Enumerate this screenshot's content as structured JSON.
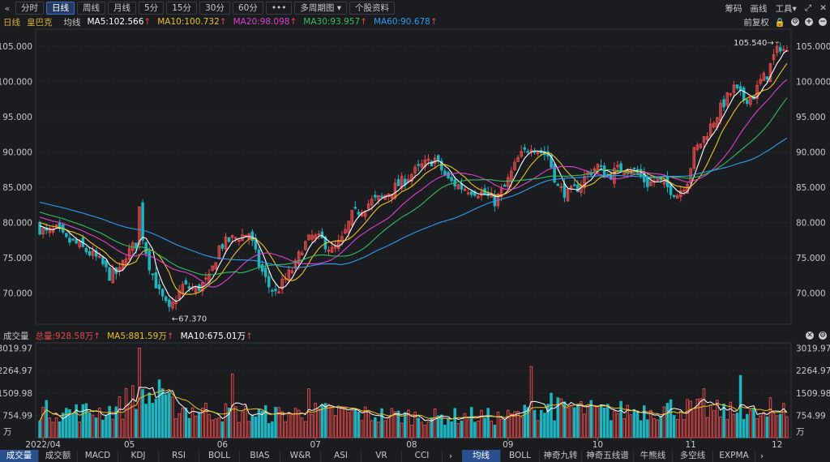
{
  "toolbar": {
    "back_icon": "double-chevron-left-icon",
    "buttons": [
      "分时",
      "日线",
      "周线",
      "月线",
      "5分",
      "15分",
      "30分",
      "60分",
      "•••",
      "多周期图",
      "个股资料"
    ],
    "active": "日线",
    "dropdown_arrow": "▾",
    "right_items": [
      "筹码",
      "画线",
      "工具"
    ],
    "right_caret": "▾",
    "window_icons": [
      "fullscreen-icon",
      "close-icon"
    ]
  },
  "ma_header": {
    "period": "日线",
    "stock_name": "皇巴克",
    "avg_label": "均线",
    "ma5": "MA5:102.566",
    "ma10": "MA10:100.732",
    "ma20": "MA20:98.098",
    "ma30": "MA30:93.957",
    "ma60": "MA60:90.678",
    "arrow": "↑",
    "adjust": "前复权"
  },
  "vol_header": {
    "label": "成交量",
    "total": "总量:928.58万",
    "ma5": "MA5:881.59万",
    "ma10": "MA10:675.01万",
    "arrow": "↑"
  },
  "colors": {
    "up": "#e34b4b",
    "down": "#1fb4bf",
    "ma5": "#ffffff",
    "ma10": "#f0c020",
    "ma20": "#e040d0",
    "ma30": "#30c060",
    "ma60": "#2a9df4",
    "grid": "#2e3038",
    "axis_text": "#c8c8c8"
  },
  "price_axis": {
    "ticks": [
      "105.000",
      "100.000",
      "95.000",
      "90.000",
      "85.000",
      "80.000",
      "75.000",
      "70.000"
    ],
    "values": [
      105,
      100,
      95,
      90,
      85,
      80,
      75,
      70
    ],
    "range": [
      65.6,
      107.4
    ]
  },
  "volume_axis": {
    "ticks": [
      "3019.97",
      "2264.97",
      "1509.98",
      "754.99"
    ],
    "values": [
      3019.97,
      2264.97,
      1509.98,
      754.99
    ],
    "unit": "万",
    "range": [
      0,
      3200
    ]
  },
  "x_axis": {
    "labels": [
      "2022/04",
      "05",
      "06",
      "07",
      "08",
      "09",
      "10",
      "11",
      "12"
    ],
    "indices": [
      1,
      27,
      55,
      83,
      112,
      141,
      168,
      196,
      222
    ]
  },
  "annotations": {
    "high": "105.540",
    "low": "67.370"
  },
  "chart_data": {
    "type": "candlestick",
    "title": "",
    "days": 226,
    "anchors": [
      [
        0,
        79.5
      ],
      [
        3,
        78.5
      ],
      [
        6,
        79
      ],
      [
        9,
        77.5
      ],
      [
        12,
        77
      ],
      [
        15,
        76
      ],
      [
        18,
        75
      ],
      [
        20,
        74
      ],
      [
        22,
        72.5
      ],
      [
        25,
        73
      ],
      [
        27,
        75.5
      ],
      [
        30,
        77
      ],
      [
        31,
        82
      ],
      [
        32,
        78
      ],
      [
        34,
        74
      ],
      [
        37,
        70
      ],
      [
        40,
        67.5
      ],
      [
        44,
        71
      ],
      [
        48,
        70.5
      ],
      [
        52,
        72
      ],
      [
        55,
        76.5
      ],
      [
        58,
        77.5
      ],
      [
        61,
        78
      ],
      [
        64,
        78.5
      ],
      [
        67,
        74
      ],
      [
        70,
        71
      ],
      [
        72,
        70
      ],
      [
        75,
        72
      ],
      [
        78,
        74
      ],
      [
        80,
        76.5
      ],
      [
        83,
        78
      ],
      [
        86,
        77.5
      ],
      [
        89,
        76
      ],
      [
        92,
        77.5
      ],
      [
        95,
        81
      ],
      [
        98,
        82
      ],
      [
        101,
        83
      ],
      [
        104,
        83.5
      ],
      [
        108,
        85
      ],
      [
        112,
        86.5
      ],
      [
        116,
        88
      ],
      [
        120,
        89
      ],
      [
        124,
        86
      ],
      [
        128,
        85
      ],
      [
        132,
        84.5
      ],
      [
        135,
        84
      ],
      [
        138,
        83
      ],
      [
        141,
        85
      ],
      [
        145,
        89
      ],
      [
        149,
        91
      ],
      [
        152,
        90
      ],
      [
        154,
        89.5
      ],
      [
        157,
        85
      ],
      [
        160,
        84
      ],
      [
        163,
        85
      ],
      [
        166,
        87
      ],
      [
        169,
        88
      ],
      [
        172,
        86.5
      ],
      [
        175,
        87.5
      ],
      [
        178,
        88
      ],
      [
        181,
        87
      ],
      [
        184,
        85.5
      ],
      [
        187,
        86
      ],
      [
        190,
        85
      ],
      [
        193,
        84
      ],
      [
        196,
        86
      ],
      [
        198,
        90
      ],
      [
        201,
        92
      ],
      [
        204,
        94.5
      ],
      [
        207,
        97
      ],
      [
        210,
        99
      ],
      [
        213,
        97.5
      ],
      [
        216,
        98
      ],
      [
        218,
        100
      ],
      [
        220,
        101
      ],
      [
        222,
        103.5
      ],
      [
        224,
        105
      ],
      [
        226,
        104
      ]
    ],
    "volume_anchors": [
      [
        0,
        950
      ],
      [
        10,
        900
      ],
      [
        20,
        950
      ],
      [
        25,
        1100
      ],
      [
        28,
        1700
      ],
      [
        32,
        1500
      ],
      [
        36,
        1300
      ],
      [
        40,
        1100
      ],
      [
        45,
        1000
      ],
      [
        50,
        950
      ],
      [
        55,
        900
      ],
      [
        60,
        850
      ],
      [
        70,
        820
      ],
      [
        80,
        880
      ],
      [
        90,
        920
      ],
      [
        100,
        800
      ],
      [
        110,
        780
      ],
      [
        120,
        720
      ],
      [
        130,
        780
      ],
      [
        140,
        700
      ],
      [
        150,
        980
      ],
      [
        160,
        1050
      ],
      [
        170,
        900
      ],
      [
        180,
        980
      ],
      [
        190,
        1050
      ],
      [
        200,
        980
      ],
      [
        210,
        880
      ],
      [
        218,
        720
      ],
      [
        226,
        900
      ]
    ],
    "spikes": [
      [
        30,
        3019.97
      ],
      [
        36,
        1950
      ],
      [
        58,
        2150
      ],
      [
        81,
        1650
      ],
      [
        148,
        2400
      ],
      [
        154,
        1500
      ],
      [
        200,
        1650
      ],
      [
        211,
        2100
      ],
      [
        220,
        1350
      ],
      [
        224,
        1150
      ]
    ],
    "high": 105.54,
    "low": 67.37
  }
}
